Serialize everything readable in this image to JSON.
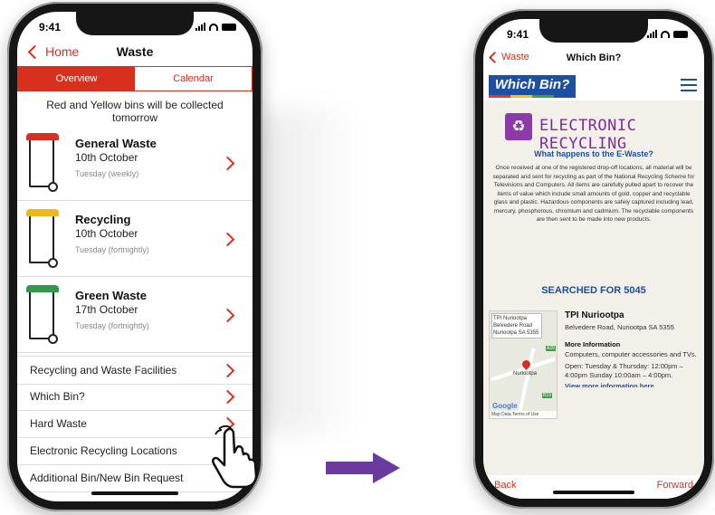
{
  "status": {
    "time": "9:41"
  },
  "left": {
    "back_label": "Home",
    "title": "Waste",
    "tabs": [
      {
        "label": "Overview",
        "active": true
      },
      {
        "label": "Calendar",
        "active": false
      }
    ],
    "notice": "Red and Yellow bins will be collected tomorrow",
    "bins": [
      {
        "name": "General Waste",
        "date": "10th October",
        "frequency": "Tuesday (weekly)",
        "lid_color": "#d8301f"
      },
      {
        "name": "Recycling",
        "date": "10th October",
        "frequency": "Tuesday (fortnightly)",
        "lid_color": "#f2b51b"
      },
      {
        "name": "Green Waste",
        "date": "17th October",
        "frequency": "Tuesday (fortnightly)",
        "lid_color": "#2f9a4a"
      }
    ],
    "menu": [
      "Recycling and Waste Facilities",
      "Which Bin?",
      "Hard Waste",
      "Electronic Recycling Locations",
      "Additional Bin/New Bin Request"
    ]
  },
  "right": {
    "back_label": "Waste",
    "title": "Which Bin?",
    "brand": "Which Bin?",
    "heading": "ELECTRONIC RECYCLING",
    "question": "What happens to the E-Waste?",
    "paragraph": "Once received at one of the registered drop-off locations, all material will be separated and sent for recycling as part of the National Recycling Scheme for Televisions and Computers. All items are carefully pulled apart to recover the items of value which include small amounts of gold, copper and recyclable glass and plastic. Hazardous components are safely captured including lead, mercury, phosphorous, chromium and cadmium. The recyclable components are then sent to be made into new products.",
    "searched": "SEARCHED FOR 5045",
    "map": {
      "label": "TPI Nuriootpa Belvedere Road Nuriootpa SA 5355",
      "town": "Nuriootpa",
      "road1": "A20",
      "road2": "B19",
      "google": "Google",
      "footer": "Map Data  Terms of Use"
    },
    "location": {
      "name": "TPI Nuriootpa",
      "address": "Belvedere Road, Nuriootpa SA 5355",
      "more_heading": "More Information",
      "description": "Computers, computer accessories and TVs.",
      "hours": "Open: Tuesday & Thursday: 12:00pm – 4:00pm Sunday 10:00am – 4:00pm.",
      "link": "View more information here"
    },
    "footer": {
      "back": "Back",
      "forward": "Forward"
    }
  },
  "colors": {
    "accent_red": "#d8301f",
    "brand_blue": "#1d4fa3",
    "purple": "#7a2f95",
    "arrow": "#6a3a9e"
  }
}
